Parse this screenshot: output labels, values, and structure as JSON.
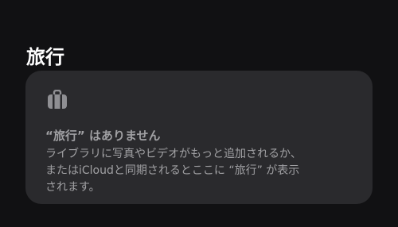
{
  "section": {
    "title": "旅行"
  },
  "empty_state": {
    "icon": "suitcase-icon",
    "title": "“旅行” はありません",
    "message": "ライブラリに写真やビデオがもっと追加されるか、\nまたはiCloudと同期されるとここに “旅行” が表示\nされます。"
  },
  "colors": {
    "background": "#111113",
    "card": "#2a2a2d",
    "secondary_text": "#a0a0a3",
    "primary_text": "#ffffff"
  }
}
